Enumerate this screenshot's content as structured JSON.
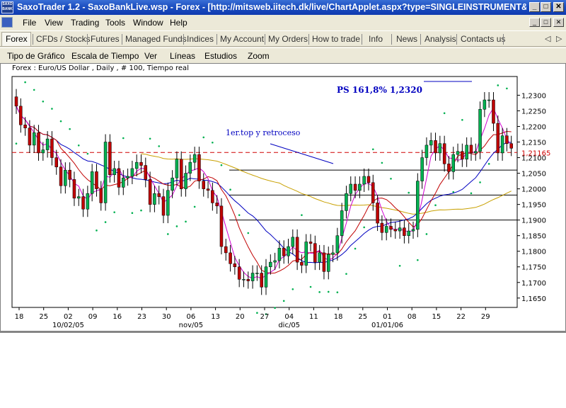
{
  "window": {
    "title": "SaxoTrader 1.2 - SaxoBankLive.wsp - Forex - [http://mitsweb.iitech.dk/live/ChartApplet.aspx?type=SINGLEINSTRUMENT&lang...",
    "icon_text": "SAXO BANK",
    "controls": [
      "_",
      "□",
      "✕"
    ]
  },
  "menu": {
    "items": [
      "File",
      "View",
      "Trading",
      "Tools",
      "Window",
      "Help"
    ],
    "mdi_controls": [
      "_",
      "□",
      "✕"
    ]
  },
  "nav": {
    "items": [
      "Forex",
      "CFDs / Stocks",
      "Futures",
      "Managed Funds",
      "Indices",
      "My Account",
      "My Orders",
      "How to trade",
      "Info",
      "News",
      "Analysis",
      "Contacts us"
    ],
    "active": "Forex",
    "arrows": [
      "◁",
      "▷"
    ]
  },
  "chart_toolbar": {
    "items": [
      "Tipo de Gráfico",
      "Escala de Tiempo",
      "Ver",
      "Líneas",
      "Estudios",
      "Zoom"
    ]
  },
  "chart_header": "Forex : Euro/US Dollar , Daily , # 100, Tiempo real",
  "colors": {
    "up": "#00b050",
    "down": "#c00000",
    "bb_mid": "#d000d0",
    "ema_red": "#c00000",
    "ema_blue": "#0000c0",
    "sma_long": "#c8a000",
    "psar": "#00b050",
    "hline": "#000000",
    "current": "#d00000",
    "annot": "#0000c0"
  },
  "chart_data": {
    "type": "candlestick",
    "instrument": "Euro/US Dollar",
    "timeframe": "Daily",
    "ylim": [
      1.162,
      1.236
    ],
    "y_ticks": [
      "1,2300",
      "1,2250",
      "1,2200",
      "1,2150",
      "1,2100",
      "1,2050",
      "1,2000",
      "1,1950",
      "1,1900",
      "1,1850",
      "1,1800",
      "1,1750",
      "1,1700",
      "1,1650"
    ],
    "x_ticks": [
      "18",
      "25",
      "02",
      "09",
      "16",
      "23",
      "30",
      "06",
      "13",
      "20",
      "27",
      "04",
      "11",
      "18",
      "25",
      "01",
      "08",
      "15",
      "22",
      "29"
    ],
    "x_sublabels": [
      {
        "label": "10/02/05",
        "at": "02"
      },
      {
        "label": "nov/05",
        "at": "06"
      },
      {
        "label": "dic/05",
        "at": "04"
      },
      {
        "label": "01/01/06",
        "at": "01"
      }
    ],
    "current_price": "1,21165",
    "current_value": 1.21165,
    "horizontal_lines": [
      1.206,
      1.198,
      1.19
    ],
    "annotations": [
      {
        "text": "1er.top y retroceso"
      },
      {
        "text": "PS 161,8% 1,2320"
      }
    ],
    "ohlc_close": [
      1.2265,
      1.2205,
      1.2195,
      1.214,
      1.218,
      1.2115,
      1.2125,
      1.216,
      1.21,
      1.207,
      1.201,
      1.206,
      1.203,
      1.197,
      1.1975,
      1.1935,
      1.1985,
      1.2055,
      1.2,
      1.1955,
      1.215,
      1.2045,
      1.2065,
      1.2005,
      1.2035,
      1.204,
      1.2065,
      1.2085,
      1.2075,
      1.203,
      1.195,
      1.1985,
      1.1975,
      1.1915,
      1.1995,
      1.2035,
      1.2095,
      1.2,
      1.205,
      1.2085,
      1.211,
      1.2025,
      1.2,
      1.1995,
      1.1955,
      1.1945,
      1.1815,
      1.1795,
      1.176,
      1.175,
      1.171,
      1.171,
      1.1705,
      1.173,
      1.173,
      1.1685,
      1.175,
      1.1765,
      1.177,
      1.181,
      1.1785,
      1.1815,
      1.1845,
      1.1765,
      1.1755,
      1.183,
      1.1825,
      1.1765,
      1.1795,
      1.1735,
      1.179,
      1.1795,
      1.185,
      1.193,
      1.1985,
      1.2015,
      1.1995,
      1.2015,
      1.204,
      1.202,
      1.1955,
      1.189,
      1.186,
      1.188,
      1.187,
      1.1865,
      1.1875,
      1.185,
      1.1865,
      1.187,
      1.2025,
      1.21,
      1.214,
      1.2155,
      1.2115,
      1.2145,
      1.208,
      1.2055,
      1.211,
      1.212,
      1.2095,
      1.214,
      1.2115,
      1.212,
      1.2255,
      1.2285,
      1.2285,
      1.221,
      1.2115,
      1.217,
      1.2145,
      1.213
    ]
  }
}
